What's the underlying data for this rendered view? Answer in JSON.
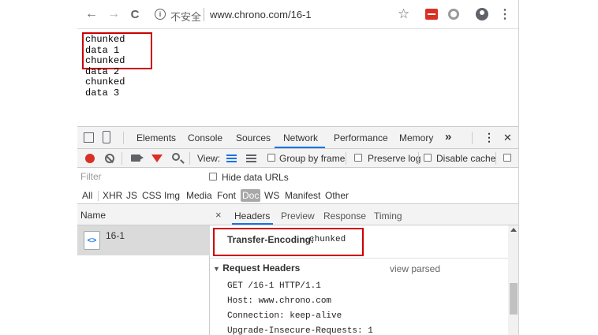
{
  "browser": {
    "nav": {
      "back": "←",
      "forward": "→",
      "reload": "C"
    },
    "omnibox": {
      "security_text": "不安全",
      "url": "www.chrono.com/16-1",
      "info_glyph": "i"
    },
    "star": "☆",
    "menu": "⋮"
  },
  "page": {
    "lines": [
      "chunked data 1",
      "chunked data 2",
      "chunked data 3"
    ]
  },
  "devtools": {
    "tabs": [
      "Elements",
      "Console",
      "Sources",
      "Network",
      "Performance",
      "Memory"
    ],
    "active_tab": "Network",
    "more": "»",
    "kebab": "⋮",
    "close": "✕",
    "toolbar": {
      "view_label": "View:",
      "group_by_frame": "Group by frame",
      "preserve_log": "Preserve log",
      "disable_cache": "Disable cache"
    },
    "filter": {
      "placeholder": "Filter",
      "hide_data_urls": "Hide data URLs"
    },
    "types": [
      "All",
      "XHR",
      "JS",
      "CSS",
      "Img",
      "Media",
      "Font",
      "Doc",
      "WS",
      "Manifest",
      "Other"
    ],
    "selected_type": "Doc",
    "requests": {
      "header": "Name",
      "rows": [
        {
          "name": "16-1",
          "icon": "<>"
        }
      ]
    },
    "detail": {
      "close": "×",
      "tabs": [
        "Headers",
        "Preview",
        "Response",
        "Timing"
      ],
      "active_tab": "Headers",
      "transfer_encoding": {
        "key": "Transfer-Encoding:",
        "value": "chunked"
      },
      "request_headers": {
        "title": "Request Headers",
        "toggle": "view parsed"
      },
      "lines": [
        "GET /16-1 HTTP/1.1",
        "Host: www.chrono.com",
        "Connection: keep-alive",
        "Upgrade-Insecure-Requests: 1"
      ]
    }
  },
  "colors": {
    "accent": "#1a73e8",
    "highlight_box": "#cc0000",
    "record": "#d93025"
  }
}
